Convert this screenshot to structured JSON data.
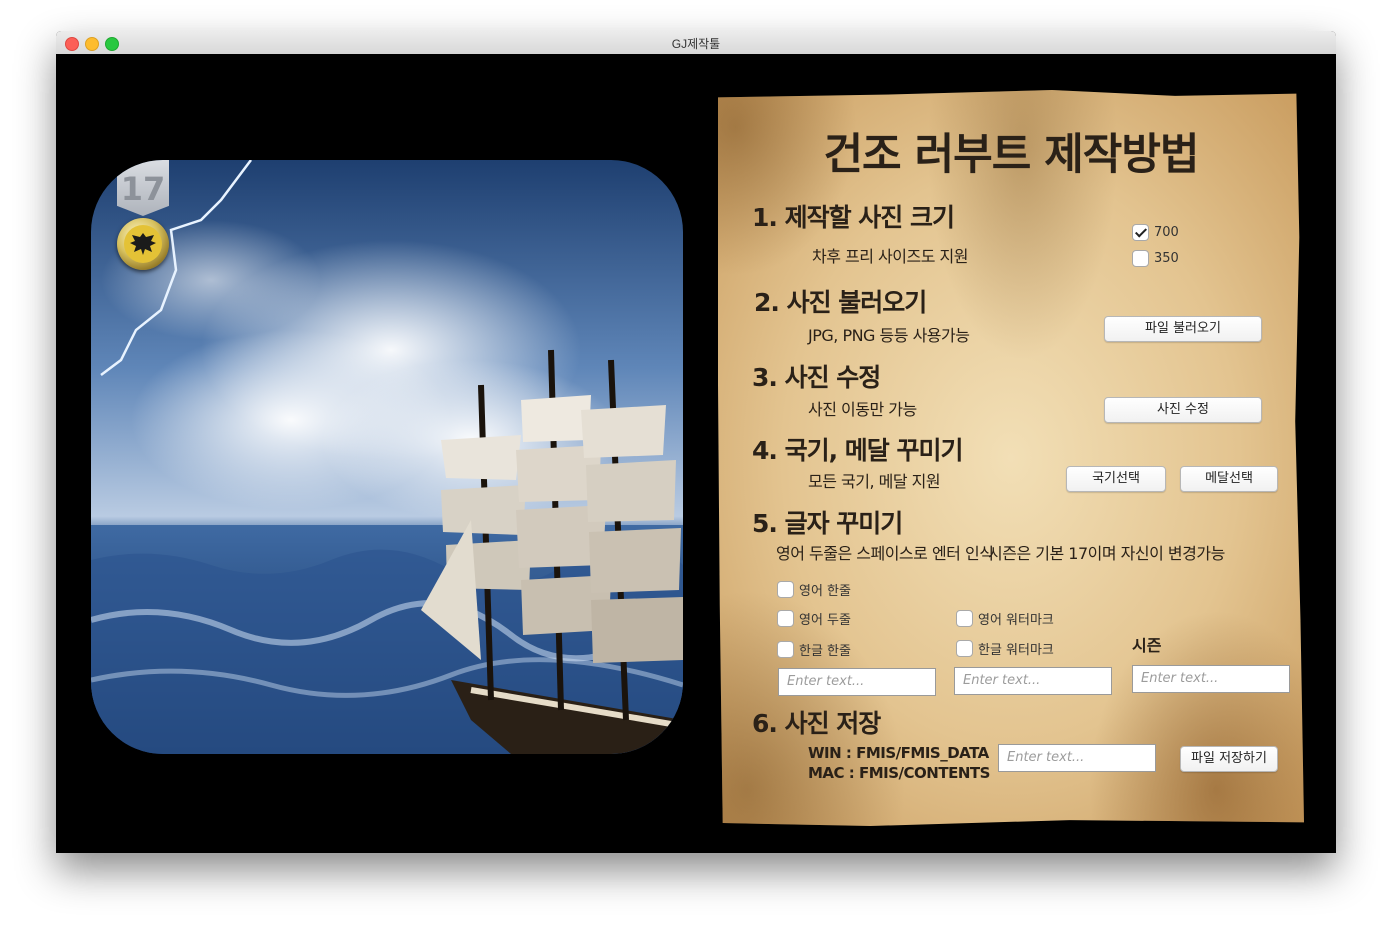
{
  "window": {
    "title": "GJ제작툴"
  },
  "preview": {
    "season_number": "17"
  },
  "guide": {
    "title": "건조 러부트 제작방법",
    "s1": {
      "heading": "1. 제작할 사진 크기",
      "desc": "차후 프리 사이즈도 지원",
      "options": [
        {
          "label": "700",
          "checked": true
        },
        {
          "label": "350",
          "checked": false
        }
      ]
    },
    "s2": {
      "heading": "2. 사진 불러오기",
      "desc": "JPG, PNG 등등 사용가능",
      "button": "파일 불러오기"
    },
    "s3": {
      "heading": "3. 사진 수정",
      "desc": "사진 이동만 가능",
      "button": "사진 수정"
    },
    "s4": {
      "heading": "4. 국기, 메달 꾸미기",
      "desc": "모든 국기, 메달 지원",
      "button_flag": "국기선택",
      "button_medal": "메달선택"
    },
    "s5": {
      "heading": "5. 글자 꾸미기",
      "desc": "영어 두줄은 스페이스로 엔터 인식",
      "desc2": "시즌은 기본 17이며 자신이 변경가능",
      "checkboxes": [
        {
          "label": "영어 한줄",
          "checked": false
        },
        {
          "label": "영어 두줄",
          "checked": false
        },
        {
          "label": "영어 워터마크",
          "checked": false
        },
        {
          "label": "한글 한줄",
          "checked": false
        },
        {
          "label": "한글 워터마크",
          "checked": false
        }
      ],
      "season_label": "시즌",
      "placeholder": "Enter text..."
    },
    "s6": {
      "heading": "6. 사진 저장",
      "win_path": "WIN : FMIS/FMIS_DATA",
      "mac_path": "MAC : FMIS/CONTENTS",
      "placeholder": "Enter text...",
      "button": "파일 저장하기"
    }
  }
}
